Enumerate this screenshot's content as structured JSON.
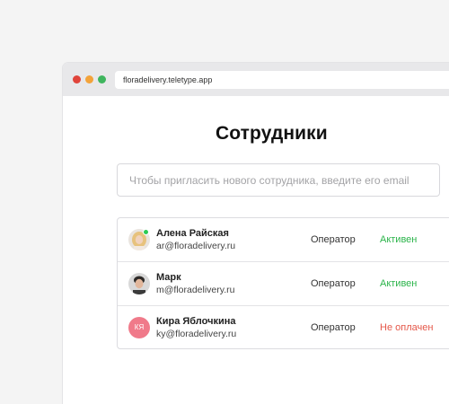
{
  "browser": {
    "url": "floradelivery.teletype.app"
  },
  "page": {
    "title": "Сотрудники",
    "invite_placeholder": "Чтобы пригласить нового сотрудника, введите его email"
  },
  "employees": [
    {
      "name": "Алена Райская",
      "email": "ar@floradelivery.ru",
      "role": "Оператор",
      "status": "Активен",
      "online": true,
      "avatar": "photo"
    },
    {
      "name": "Марк",
      "email": "m@floradelivery.ru",
      "role": "Оператор",
      "status": "Активен",
      "online": false,
      "avatar": "photo"
    },
    {
      "name": "Кира Яблочкина",
      "email": "ky@floradelivery.ru",
      "role": "Оператор",
      "status": "Не оплачен",
      "online": false,
      "avatar": "initials",
      "initials": "КЯ"
    }
  ],
  "colors": {
    "active": "#2bb44a",
    "unpaid": "#e5584a",
    "initials_bg": "#f07a8a",
    "online": "#2ccb54"
  }
}
